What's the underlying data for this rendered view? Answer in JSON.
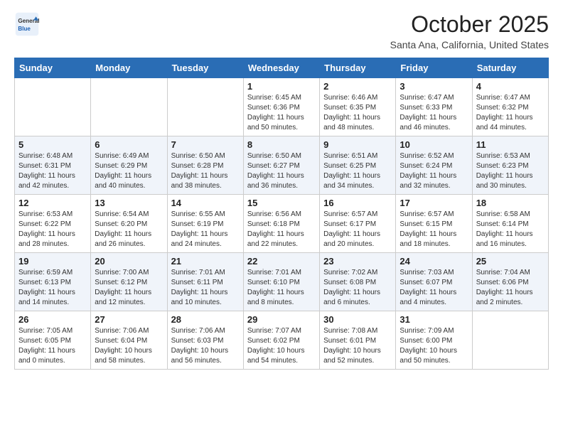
{
  "logo": {
    "general": "General",
    "blue": "Blue"
  },
  "header": {
    "month": "October 2025",
    "location": "Santa Ana, California, United States"
  },
  "days_of_week": [
    "Sunday",
    "Monday",
    "Tuesday",
    "Wednesday",
    "Thursday",
    "Friday",
    "Saturday"
  ],
  "weeks": [
    [
      {
        "day": "",
        "info": ""
      },
      {
        "day": "",
        "info": ""
      },
      {
        "day": "",
        "info": ""
      },
      {
        "day": "1",
        "info": "Sunrise: 6:45 AM\nSunset: 6:36 PM\nDaylight: 11 hours\nand 50 minutes."
      },
      {
        "day": "2",
        "info": "Sunrise: 6:46 AM\nSunset: 6:35 PM\nDaylight: 11 hours\nand 48 minutes."
      },
      {
        "day": "3",
        "info": "Sunrise: 6:47 AM\nSunset: 6:33 PM\nDaylight: 11 hours\nand 46 minutes."
      },
      {
        "day": "4",
        "info": "Sunrise: 6:47 AM\nSunset: 6:32 PM\nDaylight: 11 hours\nand 44 minutes."
      }
    ],
    [
      {
        "day": "5",
        "info": "Sunrise: 6:48 AM\nSunset: 6:31 PM\nDaylight: 11 hours\nand 42 minutes."
      },
      {
        "day": "6",
        "info": "Sunrise: 6:49 AM\nSunset: 6:29 PM\nDaylight: 11 hours\nand 40 minutes."
      },
      {
        "day": "7",
        "info": "Sunrise: 6:50 AM\nSunset: 6:28 PM\nDaylight: 11 hours\nand 38 minutes."
      },
      {
        "day": "8",
        "info": "Sunrise: 6:50 AM\nSunset: 6:27 PM\nDaylight: 11 hours\nand 36 minutes."
      },
      {
        "day": "9",
        "info": "Sunrise: 6:51 AM\nSunset: 6:25 PM\nDaylight: 11 hours\nand 34 minutes."
      },
      {
        "day": "10",
        "info": "Sunrise: 6:52 AM\nSunset: 6:24 PM\nDaylight: 11 hours\nand 32 minutes."
      },
      {
        "day": "11",
        "info": "Sunrise: 6:53 AM\nSunset: 6:23 PM\nDaylight: 11 hours\nand 30 minutes."
      }
    ],
    [
      {
        "day": "12",
        "info": "Sunrise: 6:53 AM\nSunset: 6:22 PM\nDaylight: 11 hours\nand 28 minutes."
      },
      {
        "day": "13",
        "info": "Sunrise: 6:54 AM\nSunset: 6:20 PM\nDaylight: 11 hours\nand 26 minutes."
      },
      {
        "day": "14",
        "info": "Sunrise: 6:55 AM\nSunset: 6:19 PM\nDaylight: 11 hours\nand 24 minutes."
      },
      {
        "day": "15",
        "info": "Sunrise: 6:56 AM\nSunset: 6:18 PM\nDaylight: 11 hours\nand 22 minutes."
      },
      {
        "day": "16",
        "info": "Sunrise: 6:57 AM\nSunset: 6:17 PM\nDaylight: 11 hours\nand 20 minutes."
      },
      {
        "day": "17",
        "info": "Sunrise: 6:57 AM\nSunset: 6:15 PM\nDaylight: 11 hours\nand 18 minutes."
      },
      {
        "day": "18",
        "info": "Sunrise: 6:58 AM\nSunset: 6:14 PM\nDaylight: 11 hours\nand 16 minutes."
      }
    ],
    [
      {
        "day": "19",
        "info": "Sunrise: 6:59 AM\nSunset: 6:13 PM\nDaylight: 11 hours\nand 14 minutes."
      },
      {
        "day": "20",
        "info": "Sunrise: 7:00 AM\nSunset: 6:12 PM\nDaylight: 11 hours\nand 12 minutes."
      },
      {
        "day": "21",
        "info": "Sunrise: 7:01 AM\nSunset: 6:11 PM\nDaylight: 11 hours\nand 10 minutes."
      },
      {
        "day": "22",
        "info": "Sunrise: 7:01 AM\nSunset: 6:10 PM\nDaylight: 11 hours\nand 8 minutes."
      },
      {
        "day": "23",
        "info": "Sunrise: 7:02 AM\nSunset: 6:08 PM\nDaylight: 11 hours\nand 6 minutes."
      },
      {
        "day": "24",
        "info": "Sunrise: 7:03 AM\nSunset: 6:07 PM\nDaylight: 11 hours\nand 4 minutes."
      },
      {
        "day": "25",
        "info": "Sunrise: 7:04 AM\nSunset: 6:06 PM\nDaylight: 11 hours\nand 2 minutes."
      }
    ],
    [
      {
        "day": "26",
        "info": "Sunrise: 7:05 AM\nSunset: 6:05 PM\nDaylight: 11 hours\nand 0 minutes."
      },
      {
        "day": "27",
        "info": "Sunrise: 7:06 AM\nSunset: 6:04 PM\nDaylight: 10 hours\nand 58 minutes."
      },
      {
        "day": "28",
        "info": "Sunrise: 7:06 AM\nSunset: 6:03 PM\nDaylight: 10 hours\nand 56 minutes."
      },
      {
        "day": "29",
        "info": "Sunrise: 7:07 AM\nSunset: 6:02 PM\nDaylight: 10 hours\nand 54 minutes."
      },
      {
        "day": "30",
        "info": "Sunrise: 7:08 AM\nSunset: 6:01 PM\nDaylight: 10 hours\nand 52 minutes."
      },
      {
        "day": "31",
        "info": "Sunrise: 7:09 AM\nSunset: 6:00 PM\nDaylight: 10 hours\nand 50 minutes."
      },
      {
        "day": "",
        "info": ""
      }
    ]
  ]
}
